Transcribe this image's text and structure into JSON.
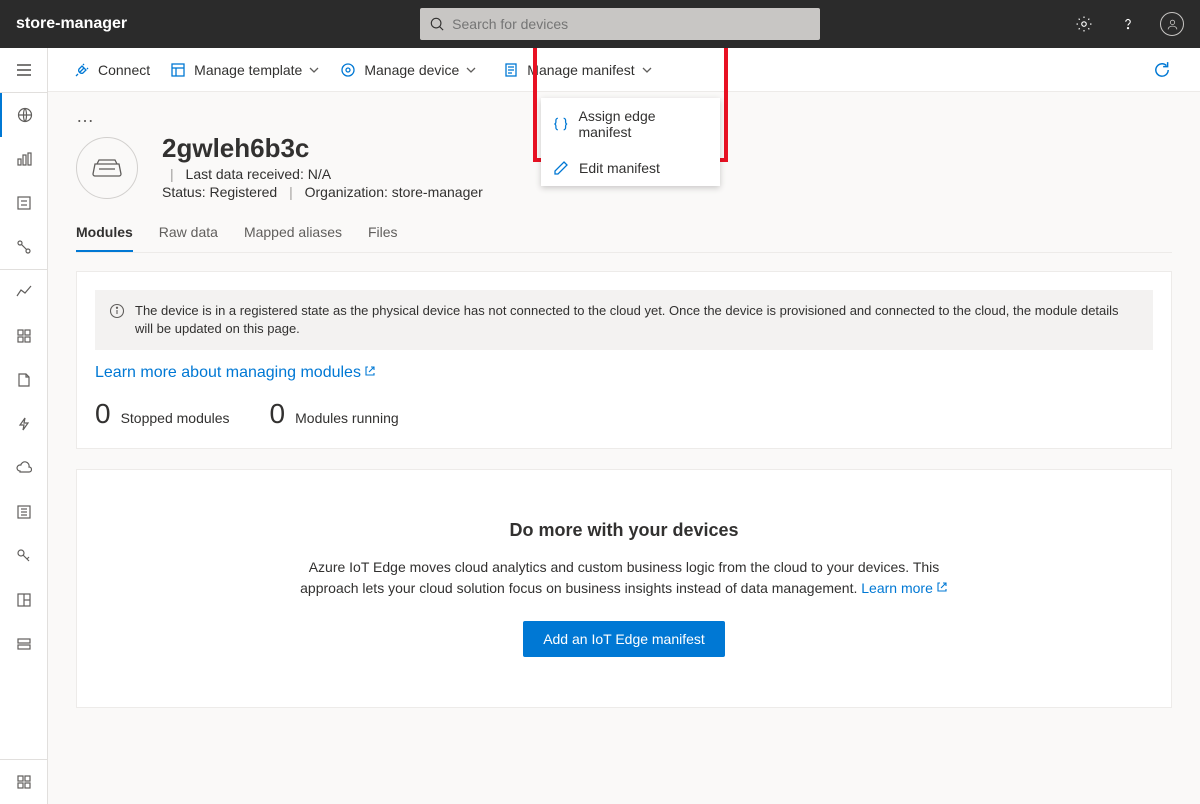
{
  "header": {
    "app_name": "store-manager",
    "search_placeholder": "Search for devices"
  },
  "commands": {
    "connect": "Connect",
    "manage_template": "Manage template",
    "manage_device": "Manage device",
    "manage_manifest": "Manage manifest"
  },
  "manifest_menu": {
    "assign": "Assign edge manifest",
    "edit": "Edit manifest"
  },
  "device": {
    "name": "2gwleh6b3c",
    "last_data_label": "Last data received:",
    "last_data_value": "N/A",
    "status_label": "Status:",
    "status_value": "Registered",
    "org_label": "Organization:",
    "org_value": "store-manager"
  },
  "tabs": {
    "modules": "Modules",
    "raw": "Raw data",
    "mapped": "Mapped aliases",
    "files": "Files"
  },
  "modules_panel": {
    "info_text": "The device is in a registered state as the physical device has not connected to the cloud yet. Once the device is provisioned and connected to the cloud, the module details will be updated on this page.",
    "learn_link": "Learn more about managing modules",
    "stopped_n": "0",
    "stopped_l": "Stopped modules",
    "running_n": "0",
    "running_l": "Modules running"
  },
  "promo": {
    "title": "Do more with your devices",
    "body": "Azure IoT Edge moves cloud analytics and custom business logic from the cloud to your devices. This approach lets your cloud solution focus on business insights instead of data management. ",
    "learn": "Learn more",
    "button": "Add an IoT Edge manifest"
  }
}
